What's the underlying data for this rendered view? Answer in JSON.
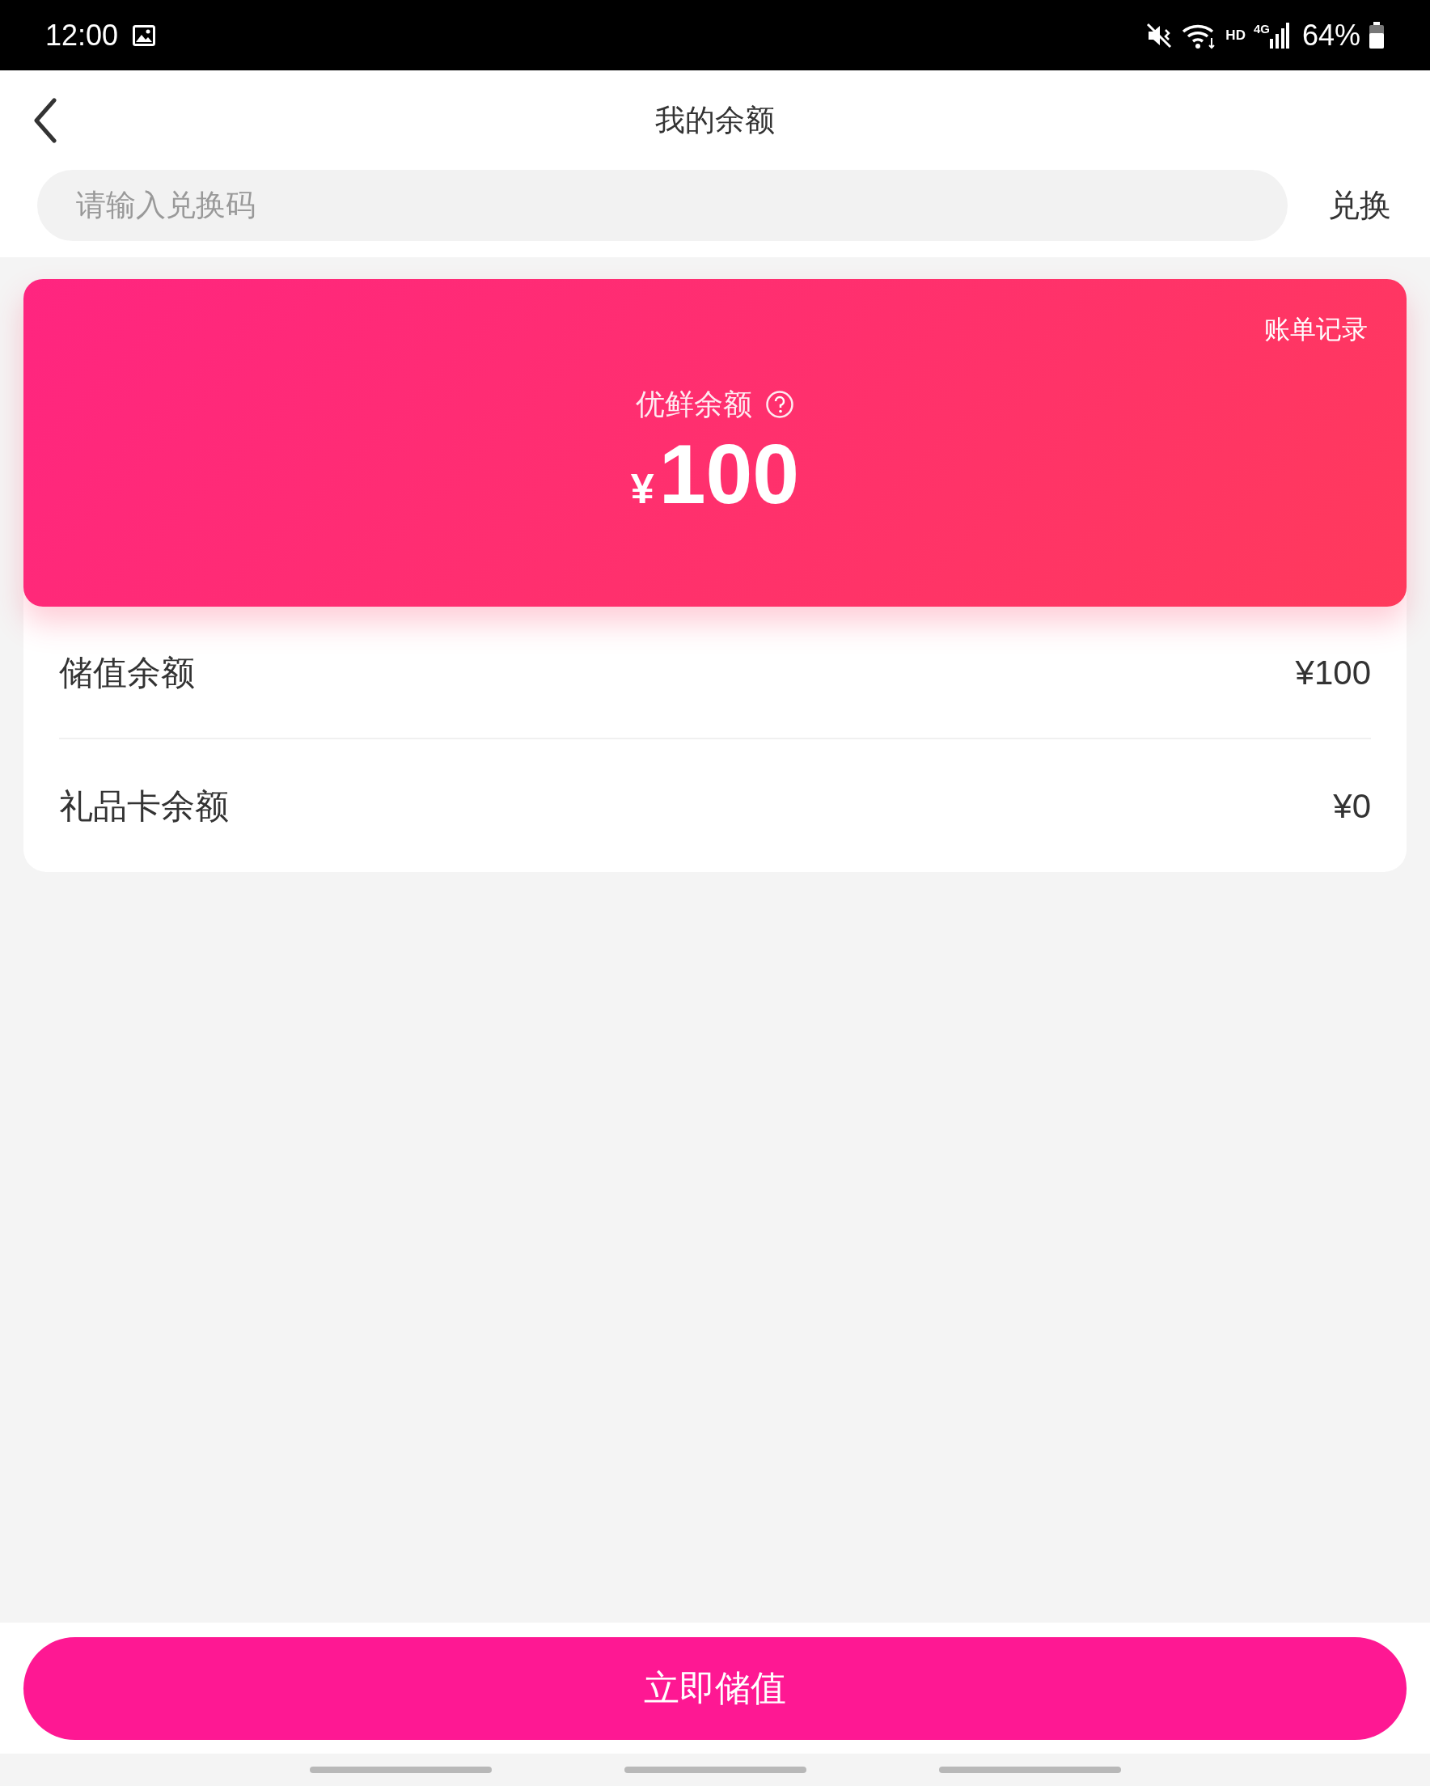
{
  "status_bar": {
    "time": "12:00",
    "hd": "HD",
    "network": "4G",
    "battery": "64%"
  },
  "header": {
    "title": "我的余额"
  },
  "redeem": {
    "placeholder": "请输入兑换码",
    "button": "兑换"
  },
  "balance_card": {
    "link": "账单记录",
    "label": "优鲜余额",
    "currency": "¥",
    "amount": "100"
  },
  "rows": [
    {
      "label": "储值余额",
      "value": "¥100"
    },
    {
      "label": "礼品卡余额",
      "value": "¥0"
    }
  ],
  "primary_button": "立即储值"
}
